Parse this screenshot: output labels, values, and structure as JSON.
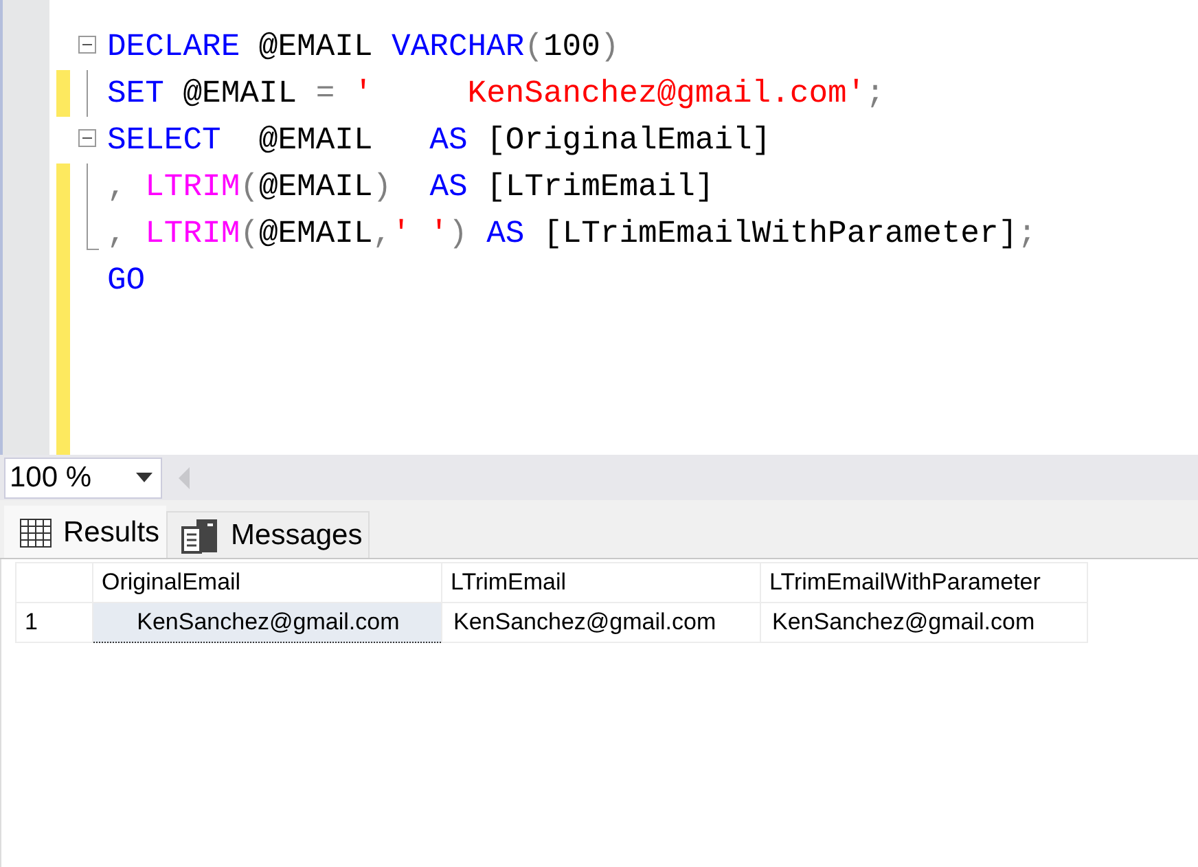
{
  "editor": {
    "lines": [
      {
        "kind": "fold-start",
        "changed": false,
        "tokens": [
          {
            "kind": "keyword",
            "text": "DECLARE"
          },
          {
            "kind": "plain",
            "text": " @EMAIL "
          },
          {
            "kind": "keyword",
            "text": "VARCHAR"
          },
          {
            "kind": "operator",
            "text": "("
          },
          {
            "kind": "plain",
            "text": "100"
          },
          {
            "kind": "operator",
            "text": ")"
          }
        ]
      },
      {
        "kind": "fold-body",
        "changed": true,
        "tokens": [
          {
            "kind": "keyword",
            "text": "SET"
          },
          {
            "kind": "plain",
            "text": " @EMAIL "
          },
          {
            "kind": "operator",
            "text": "= "
          },
          {
            "kind": "string",
            "text": "'     KenSanchez@gmail.com'"
          },
          {
            "kind": "operator",
            "text": ";"
          }
        ]
      },
      {
        "kind": "fold-start",
        "changed": false,
        "tokens": [
          {
            "kind": "keyword",
            "text": "SELECT"
          },
          {
            "kind": "plain",
            "text": "  @EMAIL   "
          },
          {
            "kind": "keyword",
            "text": "AS"
          },
          {
            "kind": "plain",
            "text": " [OriginalEmail]"
          }
        ]
      },
      {
        "kind": "fold-body",
        "changed": true,
        "tokens": [
          {
            "kind": "operator",
            "text": ", "
          },
          {
            "kind": "function",
            "text": "LTRIM"
          },
          {
            "kind": "operator",
            "text": "("
          },
          {
            "kind": "plain",
            "text": "@EMAIL"
          },
          {
            "kind": "operator",
            "text": ")  "
          },
          {
            "kind": "keyword",
            "text": "AS"
          },
          {
            "kind": "plain",
            "text": " [LTrimEmail]"
          }
        ]
      },
      {
        "kind": "fold-end",
        "changed": true,
        "tokens": [
          {
            "kind": "operator",
            "text": ", "
          },
          {
            "kind": "function",
            "text": "LTRIM"
          },
          {
            "kind": "operator",
            "text": "("
          },
          {
            "kind": "plain",
            "text": "@EMAIL"
          },
          {
            "kind": "operator",
            "text": ","
          },
          {
            "kind": "string",
            "text": "' '"
          },
          {
            "kind": "operator",
            "text": ") "
          },
          {
            "kind": "keyword",
            "text": "AS"
          },
          {
            "kind": "plain",
            "text": " [LTrimEmailWithParameter]"
          },
          {
            "kind": "operator",
            "text": ";"
          }
        ]
      },
      {
        "kind": "plain",
        "changed": true,
        "tokens": [
          {
            "kind": "keyword",
            "text": "GO"
          }
        ]
      }
    ]
  },
  "zoom": {
    "value": "100 %"
  },
  "tabs": [
    {
      "label": "Results",
      "selected": true
    },
    {
      "label": "Messages",
      "selected": false
    }
  ],
  "grid": {
    "columns": [
      "OriginalEmail",
      "LTrimEmail",
      "LTrimEmailWithParameter"
    ],
    "rows": [
      {
        "number": "1",
        "cells": [
          {
            "text": "     KenSanchez@gmail.com",
            "selected": true
          },
          {
            "text": "KenSanchez@gmail.com",
            "selected": false
          },
          {
            "text": "KenSanchez@gmail.com",
            "selected": false
          }
        ]
      }
    ]
  }
}
